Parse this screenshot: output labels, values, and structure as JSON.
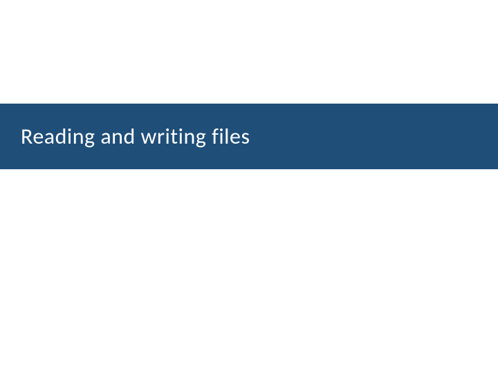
{
  "slide": {
    "title": "Reading and writing files",
    "band_color": "#1f4e79"
  }
}
